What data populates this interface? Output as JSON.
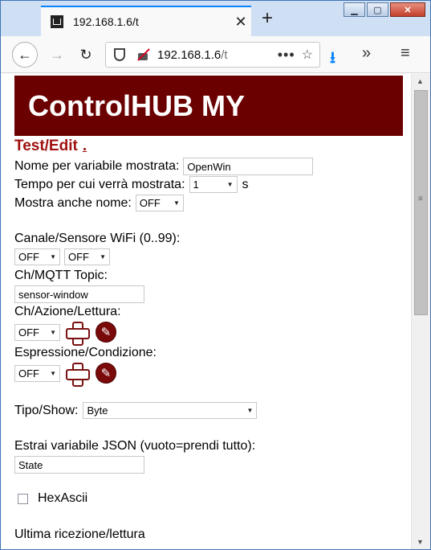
{
  "browser": {
    "tab_title": "192.168.1.6/t",
    "url_host": "192.168.1.6",
    "url_path": "/t",
    "more_label": "•••"
  },
  "page": {
    "header_title": "ControlHUB MY",
    "section_title": "Test/Edit",
    "section_link": ".",
    "name_label": "Nome per variabile mostrata:",
    "name_value": "OpenWin",
    "time_label": "Tempo per cui verrà mostrata:",
    "time_value": "1",
    "time_unit": "s",
    "show_name_label": "Mostra anche nome:",
    "show_name_value": "OFF",
    "channel_label": "Canale/Sensore WiFi (0..99):",
    "channel_sel1": "OFF",
    "channel_sel2": "OFF",
    "mqtt_label": "Ch/MQTT Topic:",
    "mqtt_value": "sensor-window",
    "action_label": "Ch/Azione/Lettura:",
    "action_value": "OFF",
    "expr_label": "Espressione/Condizione:",
    "expr_value": "OFF",
    "type_label": "Tipo/Show:",
    "type_value": "Byte",
    "json_label": "Estrai variabile JSON (vuoto=prendi tutto):",
    "json_value": "State",
    "hex_label": "HexAscii",
    "last_label": "Ultima ricezione/lettura"
  }
}
